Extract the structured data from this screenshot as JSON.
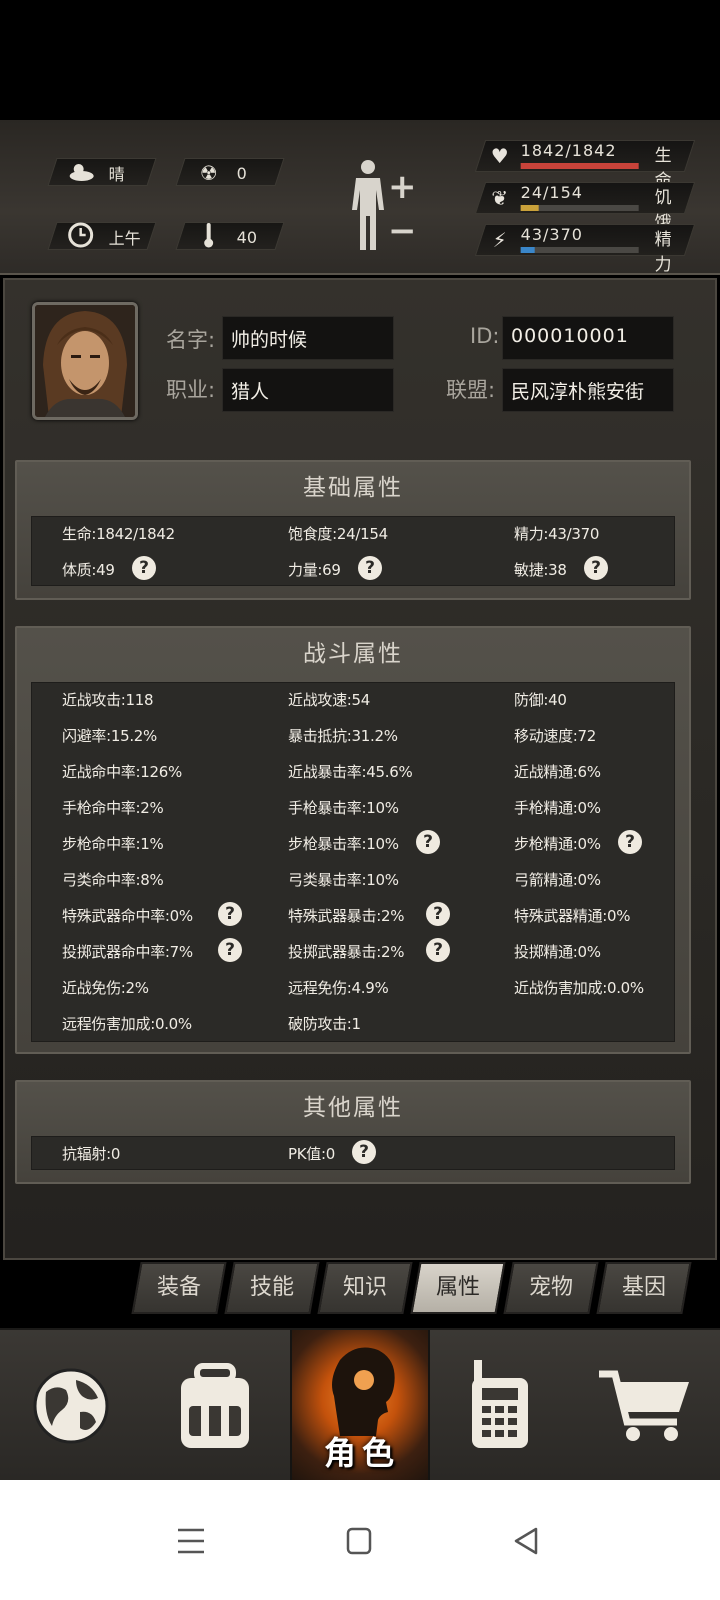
{
  "status": {
    "weather": {
      "icon": "cloud-sun-icon",
      "text": "晴"
    },
    "radiation": {
      "icon": "radiation-icon",
      "text": "0"
    },
    "time": {
      "icon": "clock-icon",
      "text": "上午"
    },
    "temperature": {
      "icon": "thermometer-icon",
      "text": "40"
    },
    "vitals": [
      {
        "icon": "heart-icon",
        "value": "1842/1842",
        "label": "生命",
        "fraction": 1.0,
        "color": "#c9433a"
      },
      {
        "icon": "stomach-icon",
        "value": "24/154",
        "label": "饥饿",
        "fraction": 0.156,
        "color": "#c9a13a"
      },
      {
        "icon": "energy-icon",
        "value": "43/370",
        "label": "精力",
        "fraction": 0.116,
        "color": "#3a86c9"
      }
    ]
  },
  "profile": {
    "name_label": "名字:",
    "name": "帅的时候",
    "job_label": "职业:",
    "job": "猎人",
    "id_label": "ID:",
    "id": "000010001",
    "alliance_label": "联盟:",
    "alliance": "民风淳朴熊安街"
  },
  "basic": {
    "title": "基础属性",
    "rows": [
      [
        "生命:1842/1842",
        "饱食度:24/154",
        "精力:43/370"
      ],
      [
        "体质:49",
        "力量:69",
        "敏捷:38"
      ]
    ]
  },
  "combat": {
    "title": "战斗属性",
    "rows": [
      [
        "近战攻击:118",
        "近战攻速:54",
        "防御:40"
      ],
      [
        "闪避率:15.2%",
        "暴击抵抗:31.2%",
        "移动速度:72"
      ],
      [
        "近战命中率:126%",
        "近战暴击率:45.6%",
        "近战精通:6%"
      ],
      [
        "手枪命中率:2%",
        "手枪暴击率:10%",
        "手枪精通:0%"
      ],
      [
        "步枪命中率:1%",
        "步枪暴击率:10%",
        "步枪精通:0%"
      ],
      [
        "弓类命中率:8%",
        "弓类暴击率:10%",
        "弓箭精通:0%"
      ],
      [
        "特殊武器命中率:0%",
        "特殊武器暴击:2%",
        "特殊武器精通:0%"
      ],
      [
        "投掷武器命中率:7%",
        "投掷武器暴击:2%",
        "投掷精通:0%"
      ],
      [
        "近战免伤:2%",
        "远程免伤:4.9%",
        "近战伤害加成:0.0%"
      ],
      [
        "远程伤害加成:0.0%",
        "破防攻击:1",
        ""
      ]
    ]
  },
  "other": {
    "title": "其他属性",
    "rows": [
      [
        "抗辐射:0",
        "PK值:0",
        ""
      ]
    ]
  },
  "help_glyph": "?",
  "tabs": [
    "装备",
    "技能",
    "知识",
    "属性",
    "宠物",
    "基因"
  ],
  "active_tab": "属性",
  "nav": {
    "active_label": "角色"
  }
}
